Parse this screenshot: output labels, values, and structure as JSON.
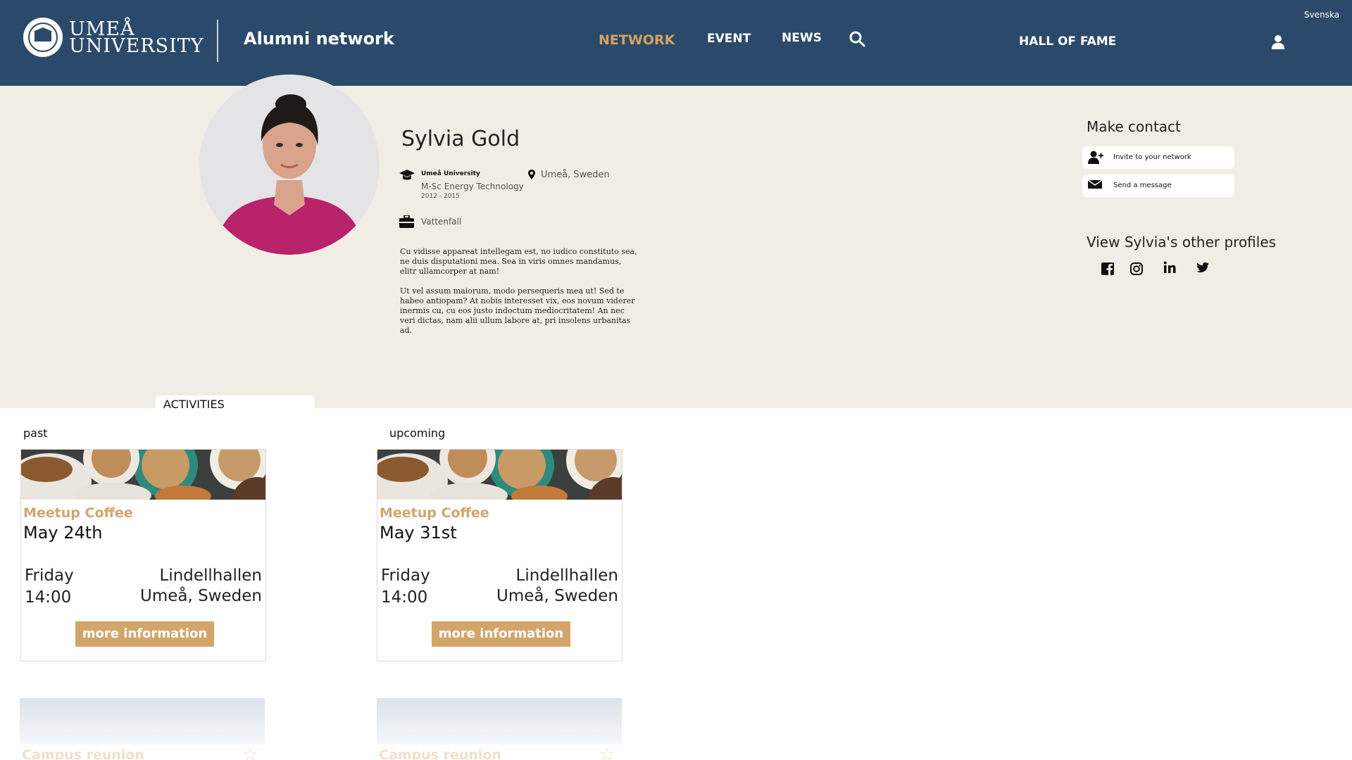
{
  "header": {
    "logo_line1": "UMEÅ",
    "logo_line2": "UNIVERSITY",
    "site_title": "Alumni network",
    "nav": {
      "network": "NETWORK",
      "event": "EVENT",
      "news": "NEWS",
      "hall_of_fame": "HALL OF FAME"
    },
    "language": "Svenska",
    "active_color": "#d6a35e",
    "background": "#2b4a6b"
  },
  "profile": {
    "name": "Sylvia Gold",
    "education": {
      "school": "Umeå University",
      "degree": "M-Sc Energy Technology",
      "years": "2012 - 2015"
    },
    "location": "Umeå, Sweden",
    "employer": "Vattenfall",
    "bio_1": "Cu vidisse appareat intellegam est, no iudico constituto sea, ne duis disputationi mea. Sea in viris omnes mandamus, elitr ullamcorper at nam!",
    "bio_2": "Ut vel assum maiorum, modo persequeris mea ut! Sed te habeo antiopam? At nobis interesset vix, eos novum viderer inermis cu, cu eos justo indoctum mediocritatem! An nec veri dictas, nam alii ullum labore at, pri insolens urbanitas ad."
  },
  "contact": {
    "heading": "Make contact",
    "invite_label": "Invite to your network",
    "message_label": "Send a message",
    "other_profiles_heading": "View Sylvia's other profiles",
    "socials": [
      "facebook-icon",
      "instagram-icon",
      "linkedin-icon",
      "twitter-icon"
    ]
  },
  "activities": {
    "tab_label": "ACTIVITIES",
    "past_label": "past",
    "upcoming_label": "upcoming",
    "past_card": {
      "category": "Meetup Coffee",
      "date": "May 24th",
      "day": "Friday",
      "time": "14:00",
      "venue": "Lindellhallen",
      "city": "Umeå, Sweden",
      "button": "more information"
    },
    "upcoming_card": {
      "category": "Meetup Coffee",
      "date": "May 31st",
      "day": "Friday",
      "time": "14:00",
      "venue": "Lindellhallen",
      "city": "Umeå, Sweden",
      "button": "more information"
    },
    "faded_cards": [
      {
        "title": "Campus reunion"
      },
      {
        "title": "Campus reunion"
      }
    ],
    "accent_color": "#d2a56b"
  }
}
